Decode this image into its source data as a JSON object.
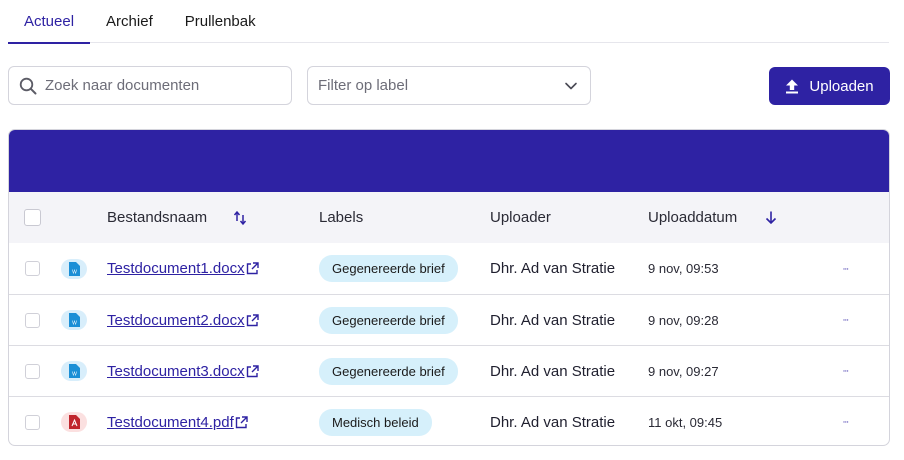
{
  "tabs": [
    {
      "label": "Actueel",
      "active": true
    },
    {
      "label": "Archief",
      "active": false
    },
    {
      "label": "Prullenbak",
      "active": false
    }
  ],
  "toolbar": {
    "search_placeholder": "Zoek naar documenten",
    "filter_placeholder": "Filter op label",
    "upload_label": "Uploaden"
  },
  "table": {
    "headers": {
      "filename": "Bestandsnaam",
      "labels": "Labels",
      "uploader": "Uploader",
      "date": "Uploaddatum"
    },
    "rows": [
      {
        "type": "word",
        "filename": "Testdocument1.docx",
        "label": "Gegenereerde brief",
        "uploader": "Dhr. Ad van Stratie",
        "date": "9 nov, 09:53"
      },
      {
        "type": "word",
        "filename": "Testdocument2.docx",
        "label": "Gegenereerde brief",
        "uploader": "Dhr. Ad van Stratie",
        "date": "9 nov, 09:28"
      },
      {
        "type": "word",
        "filename": "Testdocument3.docx",
        "label": "Gegenereerde brief",
        "uploader": "Dhr. Ad van Stratie",
        "date": "9 nov, 09:27"
      },
      {
        "type": "pdf",
        "filename": "Testdocument4.pdf",
        "label": "Medisch beleid",
        "uploader": "Dhr. Ad van Stratie",
        "date": "11 okt, 09:45"
      }
    ]
  },
  "colors": {
    "primary": "#2e22a3",
    "badge_bg": "#d6f0fb",
    "word_icon": "#1b8fd6",
    "pdf_icon": "#c0262d"
  }
}
